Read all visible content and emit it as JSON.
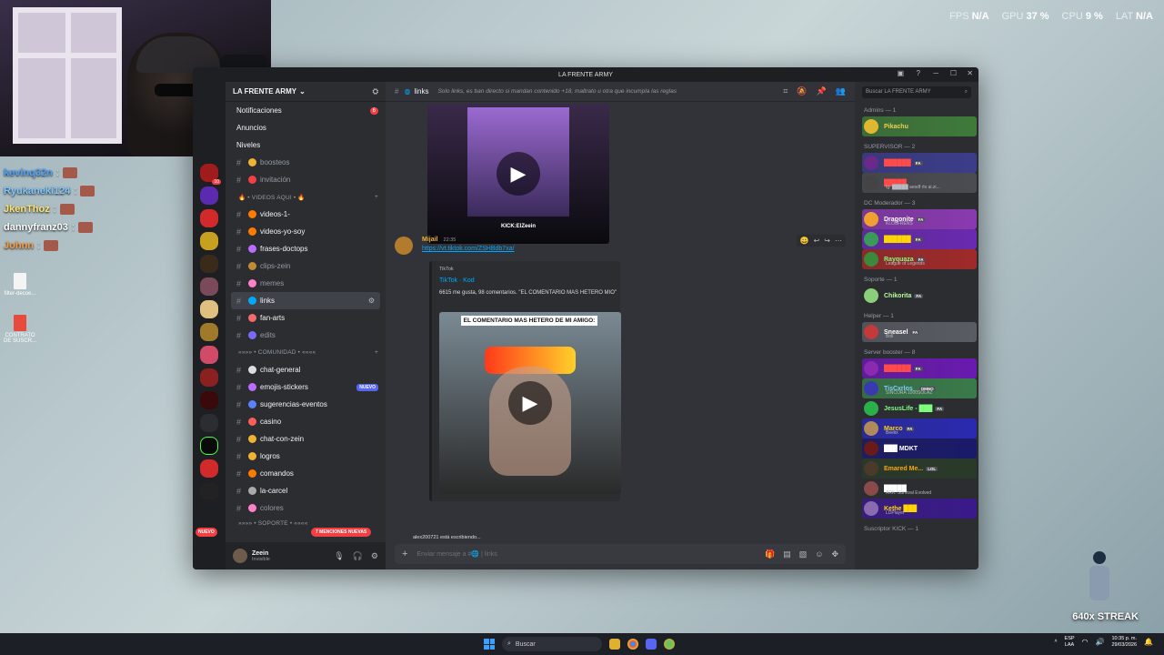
{
  "stream_overlay": {
    "stats": [
      {
        "label": "FPS",
        "value": "N/A"
      },
      {
        "label": "GPU",
        "value": "37 %"
      },
      {
        "label": "CPU",
        "value": "9 %"
      },
      {
        "label": "LAT",
        "value": "N/A"
      }
    ],
    "chat": [
      {
        "name": "kevinq32n",
        "color": "#4aa3ff"
      },
      {
        "name": "Ryukaneki124",
        "color": "#7ec6ff"
      },
      {
        "name": "JkenThoz",
        "color": "#ffe46b"
      },
      {
        "name": "dannyfranz03",
        "color": "#ffffff"
      },
      {
        "name": "Johnn",
        "color": "#ff9a3c"
      }
    ],
    "streak_label": "640x STREAK",
    "desktop_icons": [
      "filter-decoe...",
      "CONTRATO DE SUSCR..."
    ]
  },
  "window": {
    "title": "LA FRENTE ARMY"
  },
  "server": {
    "name": "LA FRENTE ARMY",
    "top_items": [
      {
        "label": "Notificaciones",
        "badge": "6"
      },
      {
        "label": "Anuncios"
      },
      {
        "label": "Niveles"
      }
    ],
    "channels_a": [
      {
        "name": "boosteos",
        "color": "#f0b232"
      },
      {
        "name": "invitación",
        "color": "#f23f43"
      }
    ],
    "category_videos": "🔥 • VIDEOS AQUI • 🔥",
    "channels_videos": [
      {
        "name": "videos-1-",
        "color": "#ff7b00",
        "bright": true
      },
      {
        "name": "videos-yo-soy",
        "color": "#ff7b00",
        "bright": true
      },
      {
        "name": "frases-doctops",
        "color": "#b96cff",
        "bright": true
      },
      {
        "name": "clips-zein",
        "color": "#c48b35"
      },
      {
        "name": "memes",
        "color": "#ff80c8"
      },
      {
        "name": "links",
        "color": "#00a8fc",
        "active": true
      },
      {
        "name": "fan-arts",
        "color": "#f26a6a",
        "bright": true
      },
      {
        "name": "edits",
        "color": "#7a6bff"
      }
    ],
    "category_comunidad": "»»»» • COMUNIDAD • ««««",
    "channels_comunidad": [
      {
        "name": "chat-general",
        "color": "#dddddd",
        "bright": true
      },
      {
        "name": "emojis-stickers",
        "color": "#b96cff",
        "bright": true,
        "nuevo": "NUEVO"
      },
      {
        "name": "sugerencias-eventos",
        "color": "#5a82ff",
        "bright": true
      },
      {
        "name": "casino",
        "color": "#ff5c5c",
        "bright": true
      },
      {
        "name": "chat-con-zein",
        "color": "#f0b232",
        "bright": true
      },
      {
        "name": "logros",
        "color": "#f0b232",
        "bright": true
      },
      {
        "name": "comandos",
        "color": "#ff7b00",
        "bright": true
      },
      {
        "name": "la-carcel",
        "color": "#aaaaaa",
        "bright": true
      },
      {
        "name": "colores",
        "color": "#ff80c8"
      }
    ],
    "category_soporte": "»»»» • SOPORTE • ««««",
    "mentions_pill": "7 MENCIONES NUEVAS",
    "nuevo_pill": "NUEVO",
    "user": {
      "name": "Zeein",
      "status": "Invisible"
    }
  },
  "chat": {
    "channel": "links",
    "topic": "Solo links, es ban directo si mandan contenido +18, maltrato u otra que incumpla las reglas",
    "top_embed_caption": "KICK:ElZeein",
    "message": {
      "author": "Mijail",
      "time": "22:35",
      "link": "https://vt.tiktok.com/ZSHBdb7xa/",
      "embed_provider": "TikTok",
      "embed_title": "TikTok · Kod",
      "embed_desc": "6615 me gusta, 98 comentarios. \"EL COMENTARIO MAS HETERO MIO\"",
      "video_caption": "EL COMENTARIO MAS HETERO DE MI AMIGO:"
    },
    "typing": "alex200721 está escribiendo...",
    "composer_placeholder": "Enviar mensaje a #🌐 | links"
  },
  "members": {
    "search_placeholder": "Buscar LA FRENTE ARMY",
    "groups": [
      {
        "title": "Admins — 1",
        "members": [
          {
            "name": "Pikachu",
            "color": "#f0d04a",
            "av": "#e0b830",
            "bg": "#3f7a3a"
          }
        ]
      },
      {
        "title": "SUPERVISOR — 2",
        "members": [
          {
            "name": "██████",
            "color": "#ff4a4a",
            "av": "#6a2a8a",
            "bg": "#3b3d8a",
            "tag": "FA"
          },
          {
            "name": "█████",
            "color": "#ff4a4a",
            "av": "#444",
            "bg": "#4a4c52",
            "status": "Ig: █████ aesdf rlo ai.zi..."
          }
        ]
      },
      {
        "title": "DC Moderador — 3",
        "members": [
          {
            "name": "Dragonite",
            "color": "#ffffff",
            "av": "#f0a030",
            "bg": "#8a3ab0",
            "tag": "FA",
            "status": "KLOuFRENS"
          },
          {
            "name": "██████",
            "color": "#ffd700",
            "av": "#3a9a5a",
            "bg": "#6a2ab0",
            "tag": "FA"
          },
          {
            "name": "Rayquaza",
            "color": "#7dff7d",
            "av": "#3a8a3a",
            "bg": "#a02a2a",
            "tag": "FA",
            "status": "League of Legends"
          }
        ]
      },
      {
        "title": "Soporte — 1",
        "members": [
          {
            "name": "Chikorita",
            "color": "#b6ff9b",
            "av": "#8ad07a",
            "tag": "FA"
          }
        ]
      },
      {
        "title": "Helper — 1",
        "members": [
          {
            "name": "Sneasel",
            "color": "#ffffff",
            "av": "#c23a3a",
            "bg": "#5a5c64",
            "tag": "FA",
            "status": "Boll"
          }
        ]
      },
      {
        "title": "Server booster — 8",
        "members": [
          {
            "name": "██████",
            "color": "#ff4a4a",
            "av": "#8a2ab0",
            "bg": "#6a1ab0",
            "tag": "FA"
          },
          {
            "name": "TisCxrlos_",
            "color": "#7dcfff",
            "av": "#3a3ab0",
            "bg": "#3a7a4a",
            "tag": "OMNO",
            "status": "SINCORA 1000SOLAZ"
          },
          {
            "name": "JesusLife - ███",
            "color": "#7dff7d",
            "av": "#2ab04a",
            "tag": "FA"
          },
          {
            "name": "Marco",
            "color": "#ffd700",
            "av": "#b08a5a",
            "bg": "#2a2ab0",
            "tag": "FA",
            "status": "Beelix"
          },
          {
            "name": "███ MDKT",
            "color": "#ffffff",
            "av": "#6a1a1a",
            "bg": "#1a1a6a"
          },
          {
            "name": "Emared Me...",
            "color": "#ffa500",
            "av": "#4a3a2a",
            "tag": "LOL",
            "bg": "#2a3a2a"
          },
          {
            "name": "█████",
            "color": "#ffffff",
            "av": "#8a4a4a",
            "status": "ARK: Survival Evolved"
          },
          {
            "name": "Kethe ███",
            "color": "#ffd700",
            "av": "#8a6ab0",
            "bg": "#3a1a8a",
            "status": "LDPlayer"
          }
        ]
      },
      {
        "title": "Suscriptor KICK — 1",
        "members": []
      }
    ]
  },
  "taskbar": {
    "search": "Buscar",
    "lang": "ESP",
    "lang2": "LAA",
    "time": "10:35 p. m.",
    "date": "29/03/2026"
  }
}
